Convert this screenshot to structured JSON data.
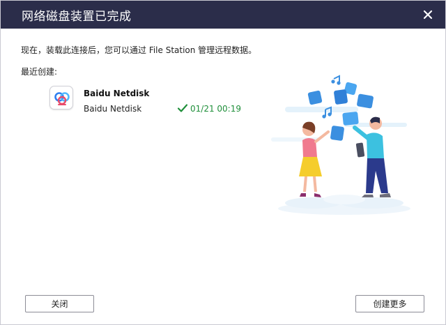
{
  "dialog": {
    "title": "网络磁盘装置已完成",
    "intro": "现在，装载此连接后，您可以通过 File Station 管理远程数据。",
    "recent_label": "最近创建:"
  },
  "connection": {
    "name": "Baidu Netdisk",
    "subtitle": "Baidu Netdisk",
    "time": "01/21 00:19"
  },
  "buttons": {
    "close": "关闭",
    "create_more": "创建更多"
  },
  "colors": {
    "titlebar": "#2b2d4a",
    "success": "#1f8f3a"
  },
  "icons": {
    "close": "close-icon",
    "app": "baidu-netdisk-icon",
    "status": "check-icon"
  }
}
